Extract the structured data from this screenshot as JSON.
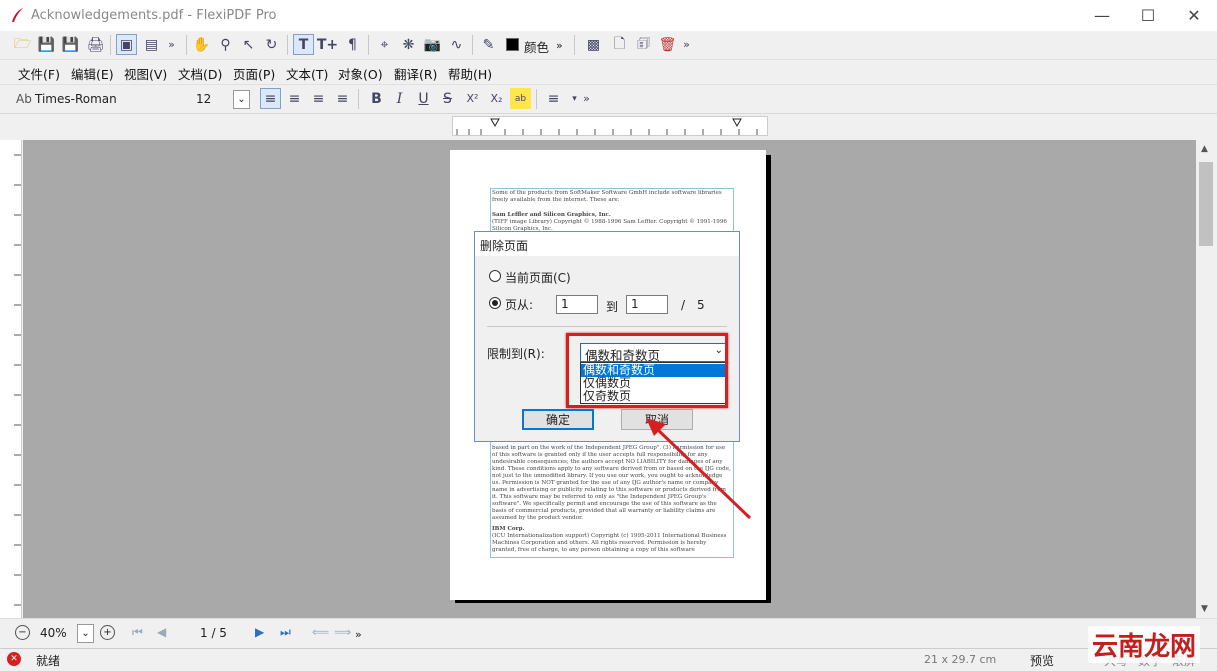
{
  "window": {
    "title": "Acknowledgements.pdf - FlexiPDF Pro",
    "minimize": "—",
    "maximize": "☐",
    "close": "✕"
  },
  "toolbar1": {
    "color_label": "颜色",
    "overflow": "»"
  },
  "menu": [
    {
      "label": "文件(F)"
    },
    {
      "label": "编辑(E)"
    },
    {
      "label": "视图(V)"
    },
    {
      "label": "文档(D)"
    },
    {
      "label": "页面(P)"
    },
    {
      "label": "文本(T)"
    },
    {
      "label": "对象(O)"
    },
    {
      "label": "翻译(R)"
    },
    {
      "label": "帮助(H)"
    }
  ],
  "format": {
    "font_prefix": "Ab",
    "font_name": "Times-Roman",
    "font_size": "12"
  },
  "document": {
    "p1": "Some of the products from SoftMaker Software GmbH include software libraries freely available from the internet. These are:",
    "p2_bold": "Sam Leffler and Silicon Graphics, Inc.",
    "p2": "(TIFF image Library) Copyright © 1988-1996 Sam Leffler. Copyright © 1991-1996 Silicon Graphics, Inc.",
    "p3": "based in part on the work of the Independent JPEG Group\". (3) Permission for use of this software is granted only if the user accepts full responsibility for any undesirable consequences; the authors accept NO LIABILITY for damages of any kind. These conditions apply to any software derived from or based on the IJG code, not just to the unmodified library. If you use our work, you ought to acknowledge us. Permission is NOT granted for the use of any IJG author's name or company name in advertising or publicity relating to this software or products derived from it. This software may be referred to only as \"the Independent JPEG Group's software\". We specifically permit and encourage the use of this software as the basis of commercial products, provided that all warranty or liability claims are assumed by the product vendor.",
    "p4_bold": "IBM Corp.",
    "p4": "(ICU Internationalization support) Copyright (c) 1995-2011 International Business Machines Corporation and others. All rights reserved. Permission is hereby granted, free of charge, to any person obtaining a copy of this software"
  },
  "dialog": {
    "title": "删除页面",
    "radio_current": "当前页面(C)",
    "radio_pages": "页从:",
    "from_value": "1",
    "to_label": "到",
    "to_value": "1",
    "slash": "/",
    "total_pages": "5",
    "limit_label": "限制到(R):",
    "limit_selected": "偶数和奇数页",
    "options": [
      "偶数和奇数页",
      "仅偶数页",
      "仅奇数页"
    ],
    "ok": "确定",
    "cancel": "取消"
  },
  "navigation": {
    "zoom": "40%",
    "page_indicator": "1 / 5"
  },
  "status": {
    "text": "就绪",
    "page_size": "21 x 29.7 cm",
    "mode": "预览",
    "caps": "大写",
    "num": "数字",
    "scroll": "滚屏"
  },
  "watermark": "云南龙网",
  "colors": {
    "accent": "#0078d7",
    "highlight_box": "#d42020",
    "canvas": "#a9a9a9"
  }
}
